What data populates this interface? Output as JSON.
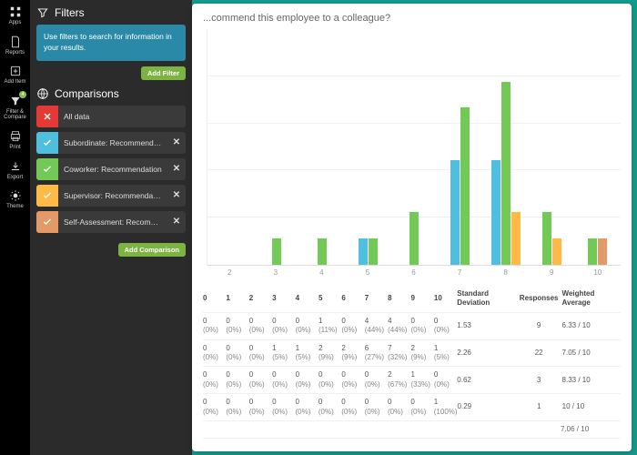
{
  "nav": {
    "items": [
      {
        "label": "Apps",
        "icon": "apps"
      },
      {
        "label": "Reports",
        "icon": "doc"
      },
      {
        "label": "Add Item",
        "icon": "plus"
      },
      {
        "label": "Filter & Compare",
        "icon": "filter",
        "badge": "4"
      },
      {
        "label": "Print",
        "icon": "print"
      },
      {
        "label": "Export",
        "icon": "export"
      },
      {
        "label": "Theme",
        "icon": "theme"
      }
    ]
  },
  "filters": {
    "title": "Filters",
    "info": "Use filters to search for information in your results.",
    "add_btn": "Add Filter"
  },
  "comparisons": {
    "title": "Comparisons",
    "add_btn": "Add Comparison",
    "items": [
      {
        "label": "All data",
        "color": "#e53935",
        "checked": false,
        "removable": false
      },
      {
        "label": "Subordinate: Recommendation",
        "color": "#4fbfe0",
        "checked": true,
        "removable": true
      },
      {
        "label": "Coworker: Recommendation",
        "color": "#73c955",
        "checked": true,
        "removable": true
      },
      {
        "label": "Supervisor: Recommendation",
        "color": "#ffb946",
        "checked": true,
        "removable": true
      },
      {
        "label": "Self-Assessment: Recommenda...",
        "color": "#e39a68",
        "checked": true,
        "removable": true
      }
    ]
  },
  "question": "...commend this employee to a colleague?",
  "chart_data": {
    "type": "bar",
    "title": "",
    "xlabel": "",
    "ylabel": "",
    "x_categories": [
      "2",
      "3",
      "4",
      "5",
      "6",
      "7",
      "8",
      "9",
      "10"
    ],
    "ylim": [
      0,
      9
    ],
    "series": [
      {
        "name": "Subordinate",
        "color": "#4fbfe0",
        "x": {
          "5": 1,
          "7": 4,
          "8": 4
        }
      },
      {
        "name": "Coworker",
        "color": "#73c955",
        "x": {
          "3": 1,
          "4": 1,
          "5": 1,
          "6": 2,
          "7": 6,
          "8": 7,
          "9": 2,
          "10": 1
        }
      },
      {
        "name": "Supervisor",
        "color": "#ffb946",
        "x": {
          "8": 2,
          "9": 1
        }
      },
      {
        "name": "Self-Assessment",
        "color": "#e39a68",
        "x": {
          "10": 1
        }
      }
    ]
  },
  "table": {
    "columns": [
      "0",
      "1",
      "2",
      "3",
      "4",
      "5",
      "6",
      "7",
      "8",
      "9",
      "10",
      "Standard Deviation",
      "Responses",
      "Weighted Average"
    ],
    "rows": [
      {
        "cells": [
          [
            "0",
            "(0%)"
          ],
          [
            "0",
            "(0%)"
          ],
          [
            "0",
            "(0%)"
          ],
          [
            "0",
            "(0%)"
          ],
          [
            "0",
            "(0%)"
          ],
          [
            "1",
            "(11%)"
          ],
          [
            "0",
            "(0%)"
          ],
          [
            "4",
            "(44%)"
          ],
          [
            "4",
            "(44%)"
          ],
          [
            "0",
            "(0%)"
          ],
          [
            "0",
            "(0%)"
          ]
        ],
        "sd": "1.53",
        "resp": "9",
        "wa": "6.33 / 10"
      },
      {
        "cells": [
          [
            "0",
            "(0%)"
          ],
          [
            "0",
            "(0%)"
          ],
          [
            "0",
            "(0%)"
          ],
          [
            "1",
            "(5%)"
          ],
          [
            "1",
            "(5%)"
          ],
          [
            "2",
            "(9%)"
          ],
          [
            "2",
            "(9%)"
          ],
          [
            "6",
            "(27%)"
          ],
          [
            "7",
            "(32%)"
          ],
          [
            "2",
            "(9%)"
          ],
          [
            "1",
            "(5%)"
          ]
        ],
        "sd": "2.26",
        "resp": "22",
        "wa": "7.05 / 10"
      },
      {
        "cells": [
          [
            "0",
            "(0%)"
          ],
          [
            "0",
            "(0%)"
          ],
          [
            "0",
            "(0%)"
          ],
          [
            "0",
            "(0%)"
          ],
          [
            "0",
            "(0%)"
          ],
          [
            "0",
            "(0%)"
          ],
          [
            "0",
            "(0%)"
          ],
          [
            "0",
            "(0%)"
          ],
          [
            "2",
            "(67%)"
          ],
          [
            "1",
            "(33%)"
          ],
          [
            "0",
            "(0%)"
          ]
        ],
        "sd": "0.62",
        "resp": "3",
        "wa": "8.33 / 10"
      },
      {
        "cells": [
          [
            "0",
            "(0%)"
          ],
          [
            "0",
            "(0%)"
          ],
          [
            "0",
            "(0%)"
          ],
          [
            "0",
            "(0%)"
          ],
          [
            "0",
            "(0%)"
          ],
          [
            "0",
            "(0%)"
          ],
          [
            "0",
            "(0%)"
          ],
          [
            "0",
            "(0%)"
          ],
          [
            "0",
            "(0%)"
          ],
          [
            "0",
            "(0%)"
          ],
          [
            "1",
            "(100%)"
          ]
        ],
        "sd": "0.29",
        "resp": "1",
        "wa": "10 / 10"
      }
    ],
    "footer_wa": "7.06 / 10"
  }
}
